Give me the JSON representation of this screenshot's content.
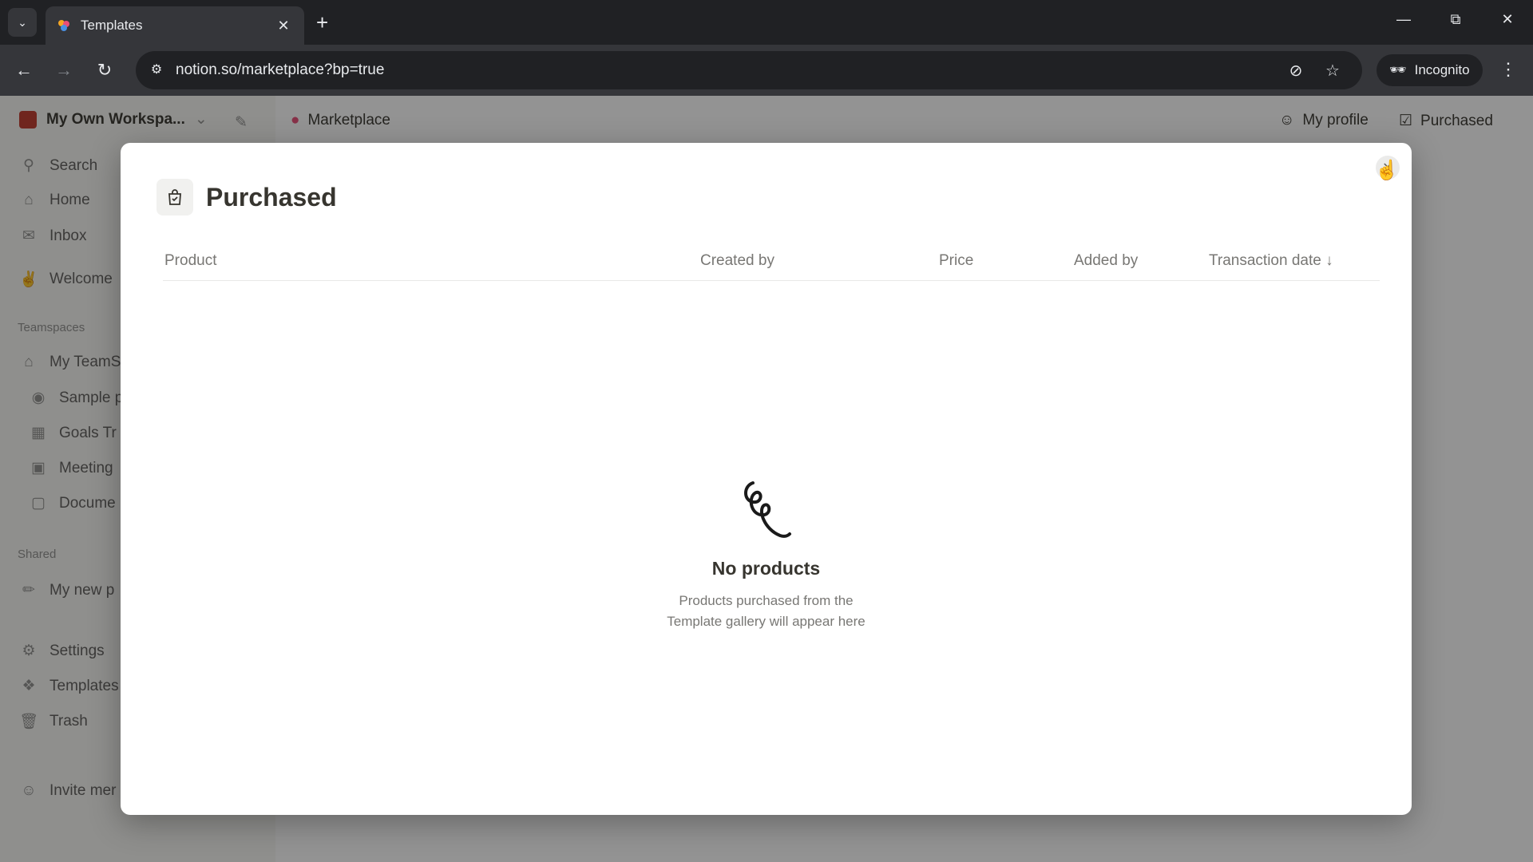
{
  "browser": {
    "tab_title": "Templates",
    "url": "notion.so/marketplace?bp=true",
    "incognito_label": "Incognito"
  },
  "app": {
    "workspace_name": "My Own Workspa...",
    "marketplace_label": "Marketplace",
    "my_profile_label": "My profile",
    "purchased_label": "Purchased",
    "sidebar": {
      "search": "Search",
      "home": "Home",
      "inbox": "Inbox",
      "welcome": "Welcome",
      "teamspaces_heading": "Teamspaces",
      "my_teamspace": "My TeamS",
      "sample": "Sample p",
      "goals": "Goals Tr",
      "meeting": "Meeting",
      "documents": "Docume",
      "shared_heading": "Shared",
      "my_new": "My new p",
      "settings": "Settings",
      "templates": "Templates",
      "trash": "Trash",
      "invite": "Invite mer"
    }
  },
  "modal": {
    "title": "Purchased",
    "columns": {
      "product": "Product",
      "created_by": "Created by",
      "price": "Price",
      "added_by": "Added by",
      "transaction_date": "Transaction date ↓"
    },
    "empty_title": "No products",
    "empty_line1": "Products purchased from the",
    "empty_line2": "Template gallery will appear here"
  }
}
